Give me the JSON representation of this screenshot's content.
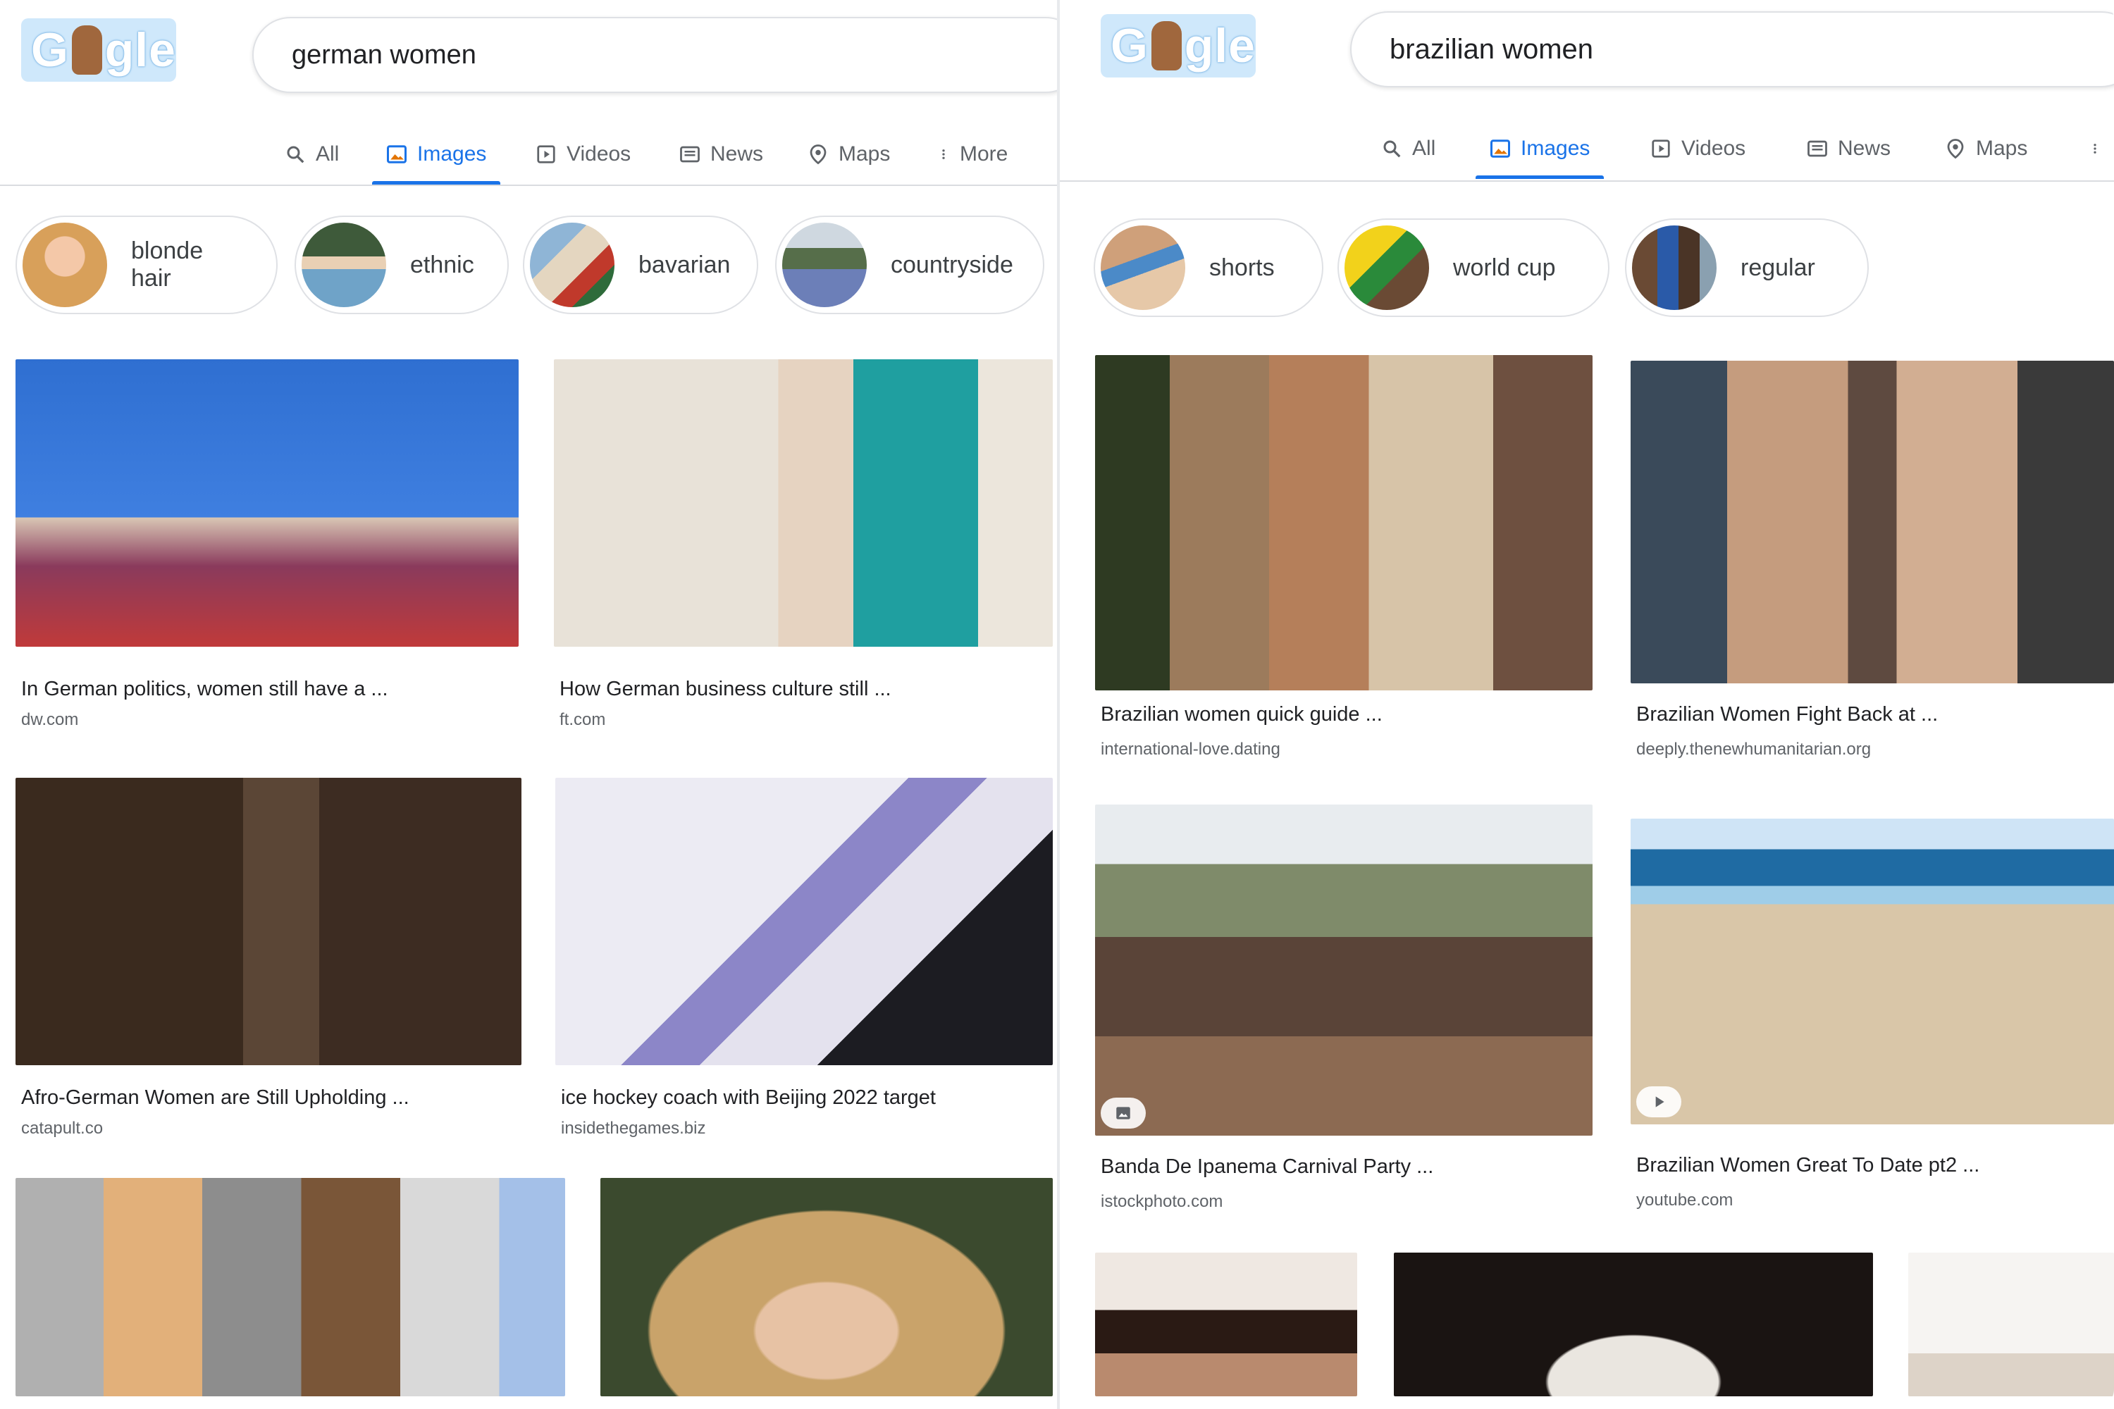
{
  "left": {
    "logo_text": "G gle",
    "search": {
      "value": "german women"
    },
    "tabs": [
      {
        "label": "All",
        "icon": "search-icon"
      },
      {
        "label": "Images",
        "icon": "image-icon",
        "active": true
      },
      {
        "label": "Videos",
        "icon": "video-icon"
      },
      {
        "label": "News",
        "icon": "news-icon"
      },
      {
        "label": "Maps",
        "icon": "map-pin-icon"
      },
      {
        "label": "More",
        "icon": "more-vert-icon"
      }
    ],
    "chips": [
      {
        "label": "blonde hair"
      },
      {
        "label": "ethnic"
      },
      {
        "label": "bavarian"
      },
      {
        "label": "countryside"
      }
    ],
    "results": [
      {
        "title": "In German politics, women still have a ...",
        "source": "dw.com"
      },
      {
        "title": "How German business culture still ...",
        "source": "ft.com"
      },
      {
        "title": "Afro-German Women are Still Upholding ...",
        "source": "catapult.co"
      },
      {
        "title": "ice hockey coach with Beijing 2022 target",
        "source": "insidethegames.biz"
      }
    ]
  },
  "right": {
    "logo_text": "G gle",
    "search": {
      "value": "brazilian women"
    },
    "tabs": [
      {
        "label": "All",
        "icon": "search-icon"
      },
      {
        "label": "Images",
        "icon": "image-icon",
        "active": true
      },
      {
        "label": "Videos",
        "icon": "video-icon"
      },
      {
        "label": "News",
        "icon": "news-icon"
      },
      {
        "label": "Maps",
        "icon": "map-pin-icon"
      }
    ],
    "chips": [
      {
        "label": "shorts"
      },
      {
        "label": "world cup"
      },
      {
        "label": "regular"
      }
    ],
    "results": [
      {
        "title": "Brazilian women quick guide ...",
        "source": "international-love.dating"
      },
      {
        "title": "Brazilian Women Fight Back at ...",
        "source": "deeply.thenewhumanitarian.org"
      },
      {
        "title": "Banda De Ipanema Carnival Party ...",
        "source": "istockphoto.com"
      },
      {
        "title": "Brazilian Women Great To Date pt2 ...",
        "source": "youtube.com"
      }
    ]
  },
  "colors": {
    "accent": "#1a73e8",
    "text": "#202124",
    "muted": "#5f6368",
    "border": "#dfe1e5"
  }
}
